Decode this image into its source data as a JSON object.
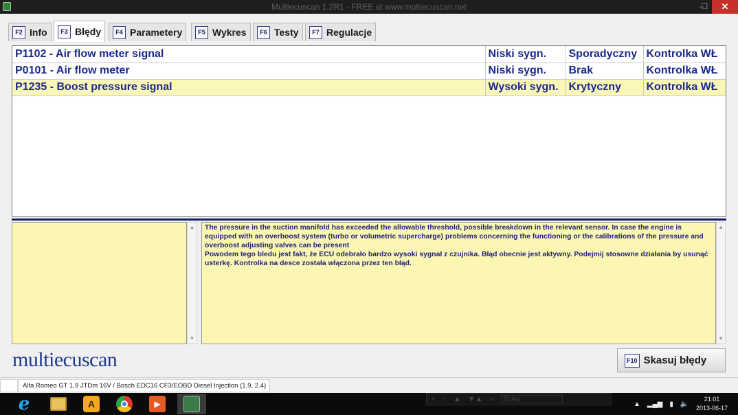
{
  "window": {
    "title": "Multiecuscan 1.2R1 - FREE at www.multiecuscan.net",
    "min_glyph": "–",
    "restore_glyph": "❐",
    "close_glyph": "✕"
  },
  "tabs": [
    {
      "key": "F2",
      "label": "Info"
    },
    {
      "key": "F3",
      "label": "Błędy"
    },
    {
      "key": "F4",
      "label": "Parametery"
    },
    {
      "key": "F5",
      "label": "Wykres"
    },
    {
      "key": "F6",
      "label": "Testy"
    },
    {
      "key": "F7",
      "label": "Regulacje"
    }
  ],
  "active_tab": "F3",
  "errors": [
    {
      "code": "P1102 - Air flow meter signal",
      "level": "Niski sygn.",
      "state": "Sporadyczny",
      "lamp": "Kontrolka WŁ"
    },
    {
      "code": "P0101 - Air flow meter",
      "level": "Niski sygn.",
      "state": "Brak",
      "lamp": "Kontrolka WŁ"
    },
    {
      "code": "P1235 - Boost pressure signal",
      "level": "Wysoki sygn.",
      "state": "Krytyczny",
      "lamp": "Kontrolka WŁ"
    }
  ],
  "description": {
    "english": "The pressure in the suction manifold has exceeded the allowable threshold, possible breakdown in the relevant sensor. In case the engine is equipped with an overboost system (turbo or volumetric supercharge) problems concerning the functioning or the calibrations of the pressure and overboost adjusting valves can be present",
    "polish": "Powodem tego bledu jest fakt, że ECU odebrało bardzo wysoki sygnał z czujnika. Błąd obecnie jest aktywny. Podejmij stosowne działania by usunąć usterkę. Kontrolka na desce została włączona przez ten błąd."
  },
  "logo": "multiecuscan",
  "clear_button": {
    "key": "F10",
    "label": "Skasuj błędy"
  },
  "status": {
    "vehicle": "Alfa Romeo GT 1.9 JTDm 16V / Bosch EDC16 CF3/EOBD Diesel Injection (1.9, 2.4)"
  },
  "taskbar": {
    "toolbar_search": "Szukaj",
    "toolbar_glyphs": [
      "+",
      "−",
      "▲",
      "▼▲",
      "⌕"
    ],
    "time": "21:01",
    "date": "2013-06-17"
  }
}
